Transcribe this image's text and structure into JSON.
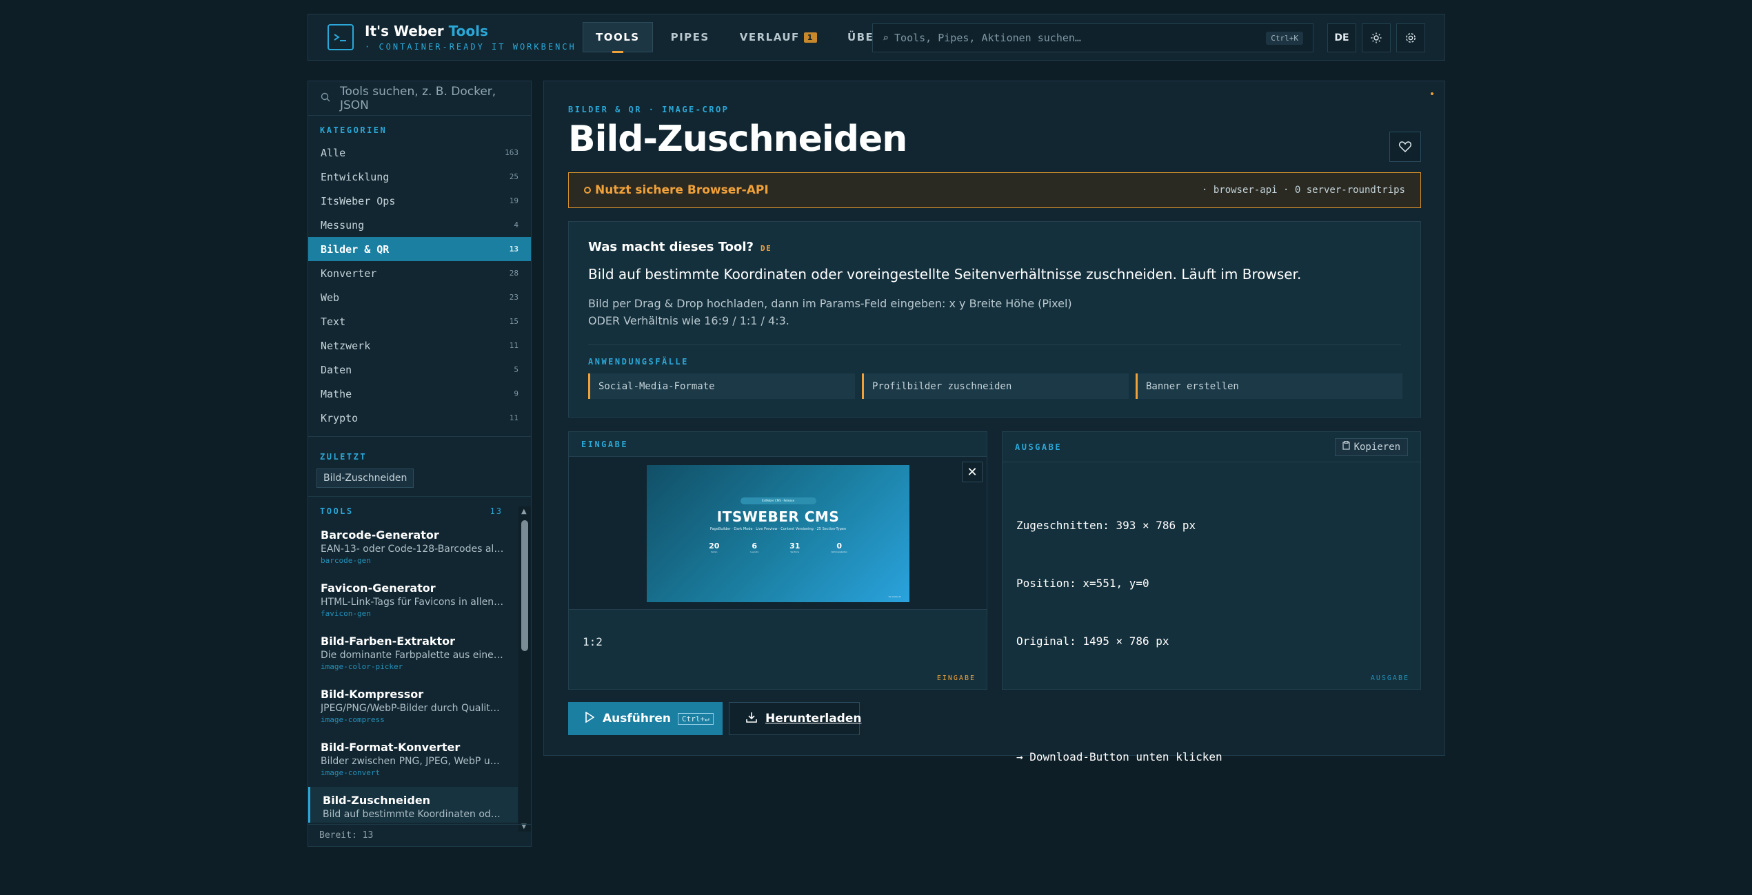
{
  "header": {
    "brand_title_a": "It's Weber ",
    "brand_title_b": "Tools",
    "brand_sub": "· CONTAINER-READY IT WORKBENCH",
    "nav": [
      {
        "label": "TOOLS"
      },
      {
        "label": "PIPES"
      },
      {
        "label": "VERLAUF",
        "badge": "1"
      },
      {
        "label": "ÜBER"
      }
    ],
    "search_placeholder": "Tools, Pipes, Aktionen suchen…",
    "search_shortcut": "Ctrl+K",
    "lang": "DE"
  },
  "sidebar": {
    "search_placeholder": "Tools suchen, z. B. Docker, JSON",
    "categories_title": "KATEGORIEN",
    "categories": [
      {
        "label": "Alle",
        "count": "163"
      },
      {
        "label": "Entwicklung",
        "count": "25"
      },
      {
        "label": "ItsWeber Ops",
        "count": "19"
      },
      {
        "label": "Messung",
        "count": "4"
      },
      {
        "label": "Bilder & QR",
        "count": "13"
      },
      {
        "label": "Konverter",
        "count": "28"
      },
      {
        "label": "Web",
        "count": "23"
      },
      {
        "label": "Text",
        "count": "15"
      },
      {
        "label": "Netzwerk",
        "count": "11"
      },
      {
        "label": "Daten",
        "count": "5"
      },
      {
        "label": "Mathe",
        "count": "9"
      },
      {
        "label": "Krypto",
        "count": "11"
      }
    ],
    "recent_title": "ZULETZT",
    "recent_item": "Bild-Zuschneiden",
    "tools_title": "TOOLS",
    "tools_count": "13",
    "tools": [
      {
        "title": "Barcode-Generator",
        "desc": "EAN-13- oder Code-128-Barcodes als …",
        "slug": "barcode-gen"
      },
      {
        "title": "Favicon-Generator",
        "desc": "HTML-Link-Tags für Favicons in allen b…",
        "slug": "favicon-gen"
      },
      {
        "title": "Bild-Farben-Extraktor",
        "desc": "Die dominante Farbpalette aus einem b…",
        "slug": "image-color-picker"
      },
      {
        "title": "Bild-Kompressor",
        "desc": "JPEG/PNG/WebP-Bilder durch Qualität…",
        "slug": "image-compress"
      },
      {
        "title": "Bild-Format-Konverter",
        "desc": "Bilder zwischen PNG, JPEG, WebP und…",
        "slug": "image-convert"
      },
      {
        "title": "Bild-Zuschneiden",
        "desc": "Bild auf bestimmte Koordinaten oder v…",
        "slug": ""
      }
    ],
    "footer": "Bereit: 13"
  },
  "main": {
    "breadcrumb": "BILDER & QR · IMAGE-CROP",
    "title": "Bild-Zuschneiden",
    "api_label": "Nutzt sichere Browser-API",
    "api_meta": "· browser-api · 0 server-roundtrips",
    "info_question": "Was macht dieses Tool?",
    "info_lang": "DE",
    "info_lead": "Bild auf bestimmte Koordinaten oder voreingestellte Seitenverhältnisse zuschneiden. Läuft im Browser.",
    "info_line1": "Bild per Drag & Drop hochladen, dann im Params-Feld eingeben: x y Breite Höhe (Pixel)",
    "info_line2": "ODER Verhältnis wie 16:9 / 1:1 / 4:3.",
    "use_title": "ANWENDUNGSFÄLLE",
    "use_cases": [
      "Social-Media-Formate",
      "Profilbilder zuschneiden",
      "Banner erstellen"
    ],
    "input_title": "EINGABE",
    "input_corner": "EINGABE",
    "params_value": "1:2",
    "output_title": "AUSGABE",
    "output_corner": "AUSGABE",
    "copy_label": "Kopieren",
    "output_lines": [
      "Zugeschnitten: 393 × 786 px",
      "Position: x=551, y=0",
      "Original: 1495 × 786 px",
      "",
      "→ Download-Button unten klicken"
    ],
    "run_label": "Ausführen",
    "run_shortcut": "Ctrl+↵",
    "download_label": "Herunterladen"
  },
  "preview": {
    "pill": "ItsWeber CMS · Release",
    "title": "ITSWEBER CMS",
    "sub": "PageBuilder · Dark Mode · Live Preview · Content Versioning · 25 Section-Typen",
    "stats": [
      {
        "v": "20",
        "l": "Seiten"
      },
      {
        "v": "6",
        "l": "Layouts"
      },
      {
        "v": "31",
        "l": "Sections"
      },
      {
        "v": "0",
        "l": "Abhängigkeiten"
      }
    ],
    "foot": "its-weber.de"
  },
  "colors": {
    "accent": "#2ba8d8",
    "warning": "#f0a13a",
    "active": "#1b7fa2",
    "background": "#0e1e27"
  }
}
